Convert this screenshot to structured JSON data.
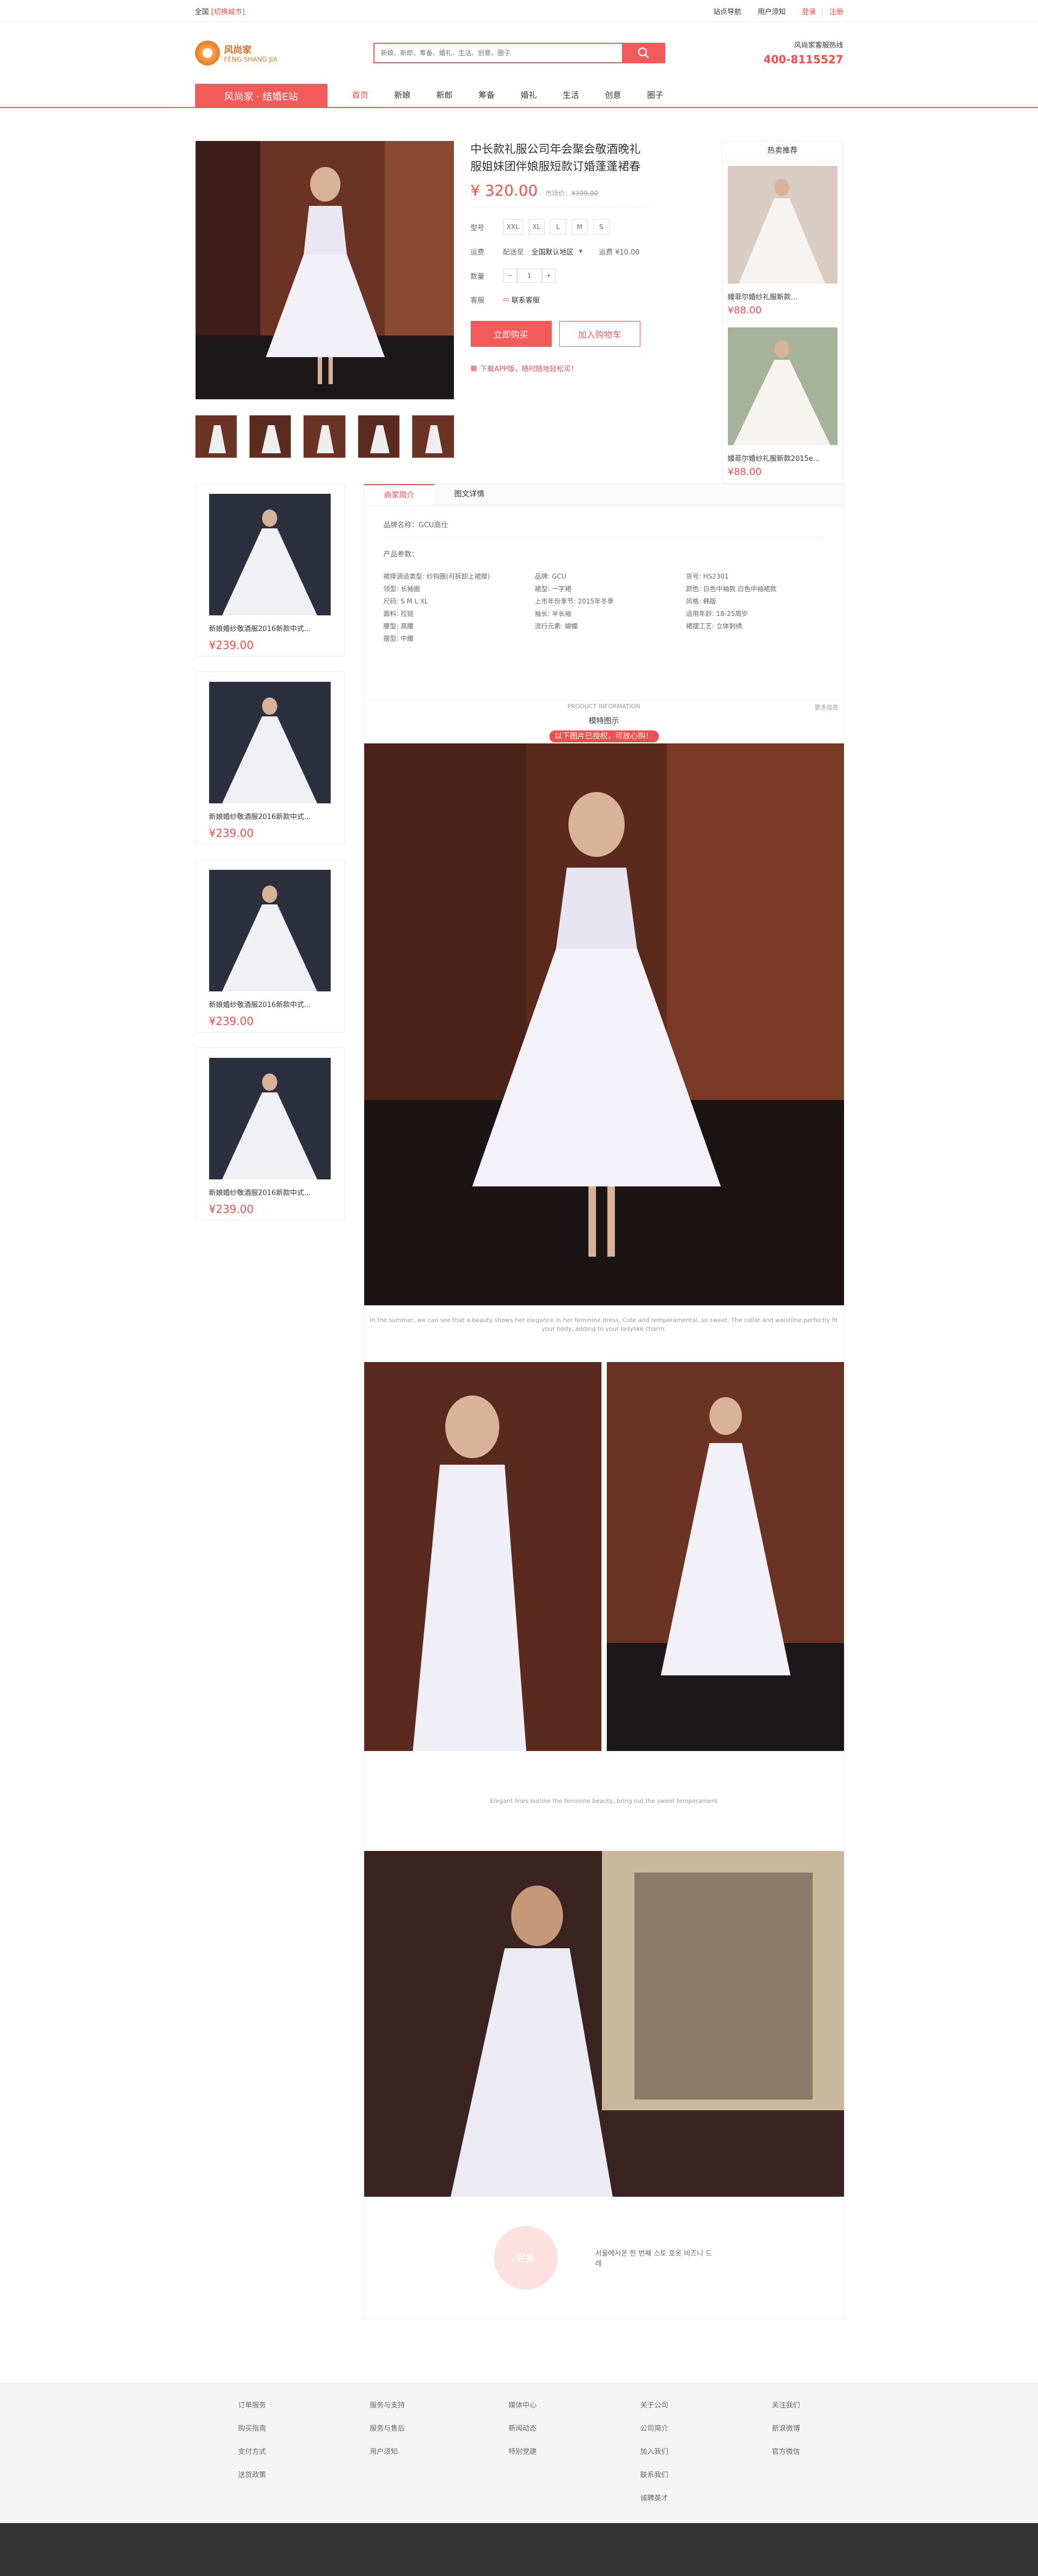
{
  "topbar": {
    "region": "全国",
    "switch_label": "[切换城市]",
    "links": [
      "站点导航",
      "用户须知"
    ],
    "login": "登录",
    "register": "注册"
  },
  "header": {
    "brand_name": "风尚家",
    "brand_sub": "FENG SHANG JIA",
    "search_placeholder": "新娘、新郎、筹备、婚礼、生活、创意、圈子",
    "hotline_label": "风尚家客服热线",
    "hotline_number": "400-8115527"
  },
  "nav": {
    "site_label": "风尚家 · 结婚E站",
    "items": [
      "首页",
      "新娘",
      "新郎",
      "筹备",
      "婚礼",
      "生活",
      "创意",
      "圈子"
    ]
  },
  "product": {
    "title": "中长款礼服公司年会聚会敬酒晚礼服姐妹团伴娘服短款订婚蓬蓬裙春",
    "price": "¥ 320.00",
    "market_price_label": "市场价：",
    "market_price": "¥399.00",
    "size_label": "型号",
    "sizes": [
      "XXL",
      "XL",
      "L",
      "M",
      "S"
    ],
    "shipping_label": "运费",
    "ship_from": "配送至",
    "ship_area": "全国默认地区",
    "ship_fee": "运费 ¥10.00",
    "qty_label": "数量",
    "qty": "1",
    "service_label": "客服",
    "service_value": "联系客服",
    "buy_now": "立即购买",
    "add_cart": "加入购物车",
    "app_tip": "下载APP版，随时随地轻松买！"
  },
  "hot": {
    "title": "热卖推荐",
    "items": [
      {
        "name": "嫚菲尔婚纱礼服新款...",
        "price": "¥88.00"
      },
      {
        "name": "嫚菲尔婚纱礼服新款2015e...",
        "price": "¥88.00"
      }
    ]
  },
  "side": {
    "items": [
      {
        "name": "新娘婚纱敬酒服2016新款中式...",
        "price": "¥239.00"
      },
      {
        "name": "新娘婚纱敬酒服2016新款中式...",
        "price": "¥239.00"
      },
      {
        "name": "新娘婚纱敬酒服2016新款中式...",
        "price": "¥239.00"
      },
      {
        "name": "新娘婚纱敬酒服2016新款中式...",
        "price": "¥239.00"
      }
    ]
  },
  "detail": {
    "tabs": [
      "商家简介",
      "图文详情"
    ],
    "brand_line": "品牌名称：GCU高仕",
    "params_title": "产品参数：",
    "params": [
      "裙撑调适类型: 纱钩圈(可拆卸上裙撑)",
      "品牌: GCU",
      "货号: HS2301",
      "领型: 长袖圈",
      "裙型: 一字裙",
      "颜色: 白色中袖款 白色中袖裙款",
      "尺码: S M L XL",
      "上市年份季节: 2015年冬季",
      "风格: 韩版",
      "面料: 拉链",
      "袖长: 半长袖",
      "适用年龄: 18-25周岁",
      "腰型: 高腰",
      "流行元素: 蝴蝶",
      "裙摆工艺: 立体刺绣",
      "摆型: 中腰"
    ],
    "notice_small": "PRODUCT INFORMATION",
    "notice_more": "更多信息",
    "notice_title": "模特图示",
    "notice_tag": "以下图片已授权，可放心购！",
    "caption": "In the summer, we can see that a beauty shows her elegance in her feminine dress. Cute and temperamental, so sweet. The collar and waistline perfectly fit your body, adding to your ladylike charm.",
    "sig_text": "Elegant lines outline the feminine beauty, bring out the sweet temperament",
    "circle_text": "完美",
    "bottom_text": "서울에서온 한 번째 스토 호옷 비즈니 드레"
  },
  "footer": {
    "cols": [
      [
        "订单服务",
        "购买指南",
        "支付方式",
        "送货政策"
      ],
      [
        "服务与支持",
        "服务与售后",
        "用户须知"
      ],
      [
        "媒体中心",
        "新闻动态",
        "特别党建"
      ],
      [
        "关于公司",
        "公司简介",
        "加入我们",
        "联系我们",
        "诚聘英才"
      ],
      [
        "关注我们",
        "新浪微博",
        "官方微信"
      ]
    ]
  }
}
